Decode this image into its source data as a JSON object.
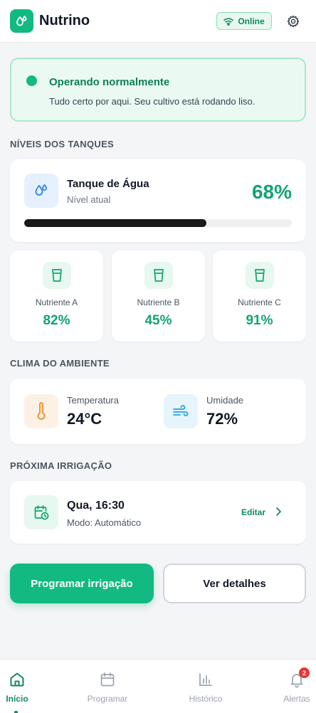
{
  "header": {
    "app_title": "Nutrino",
    "status_pill": "Online",
    "logo_icon": "water-drops-icon",
    "settings_icon": "gear-icon"
  },
  "status": {
    "title": "Operando normalmente",
    "message": "Tudo certo por aqui. Seu cultivo está rodando liso."
  },
  "tanks": {
    "section_title": "NÍVEIS DOS TANQUES",
    "water": {
      "name": "Tanque de Água",
      "sublabel": "Nível atual",
      "percent_label": "68%",
      "fill_fraction": 0.68
    },
    "nutrients": [
      {
        "name": "Nutriente A",
        "value": "82%"
      },
      {
        "name": "Nutriente B",
        "value": "45%"
      },
      {
        "name": "Nutriente C",
        "value": "91%"
      }
    ]
  },
  "climate": {
    "section_title": "CLIMA DO AMBIENTE",
    "temperature": {
      "label": "Temperatura",
      "value": "24°C",
      "icon": "thermometer-icon"
    },
    "humidity": {
      "label": "Umidade",
      "value": "72%",
      "icon": "wind-icon"
    }
  },
  "irrigation": {
    "section_title": "PRÓXIMA IRRIGAÇÃO",
    "when": "Qua, 16:30",
    "mode": "Modo: Automático",
    "edit_label": "Editar"
  },
  "actions": {
    "primary": "Programar irrigação",
    "secondary": "Ver detalhes"
  },
  "nav": {
    "items": [
      {
        "label": "Início",
        "icon": "home-icon",
        "active": true
      },
      {
        "label": "Programar",
        "icon": "calendar-icon",
        "active": false
      },
      {
        "label": "Histórico",
        "icon": "bar-chart-icon",
        "active": false
      },
      {
        "label": "Alertas",
        "icon": "bell-icon",
        "active": false,
        "badge": "2"
      }
    ]
  },
  "colors": {
    "accent": "#12b981",
    "accent_dark": "#0f8a5f",
    "alert_badge": "#e53935"
  }
}
